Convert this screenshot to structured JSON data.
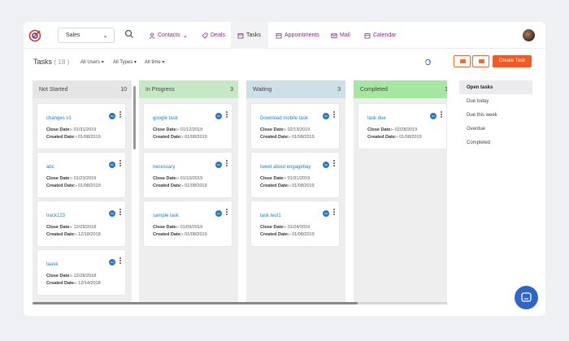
{
  "nav": {
    "dropdown": "Sales",
    "items": [
      {
        "label": "Contacts",
        "icon": "contacts-icon"
      },
      {
        "label": "Deals",
        "icon": "deals-icon"
      },
      {
        "label": "Tasks",
        "icon": "tasks-icon",
        "active": true
      },
      {
        "label": "Appointments",
        "icon": "calendar-icon"
      },
      {
        "label": "Mail",
        "icon": "mail-icon"
      },
      {
        "label": "Calendar",
        "icon": "calendar-icon"
      }
    ]
  },
  "header": {
    "title": "Tasks",
    "count": "( 18 )",
    "filters": [
      "All Users",
      "All Types",
      "All time"
    ],
    "create_label": "Create Task"
  },
  "columns": [
    {
      "name": "Not Started",
      "count": "10",
      "color": "#e5e5e5",
      "cards": [
        {
          "name": "changes v1",
          "close": "01/31/2019",
          "created": "01/08/2019"
        },
        {
          "name": "abc",
          "close": "01/23/2019",
          "created": "01/08/2019"
        },
        {
          "name": "track123",
          "close": "12/29/2018",
          "created": "12/18/2018"
        },
        {
          "name": "taask",
          "close": "12/28/2018",
          "created": "12/14/2018"
        }
      ]
    },
    {
      "name": "In Progress",
      "count": "3",
      "color": "#c7e8c4",
      "cards": [
        {
          "name": "google task",
          "close": "01/12/2019",
          "created": "01/08/2019"
        },
        {
          "name": "necessary",
          "close": "01/10/2019",
          "created": "01/08/2019"
        },
        {
          "name": "sample task",
          "close": "01/09/2019",
          "created": "01/08/2019"
        }
      ]
    },
    {
      "name": "Waiting",
      "count": "3",
      "color": "#cde0e8",
      "cards": [
        {
          "name": "Download mobile task",
          "close": "02/13/2019",
          "created": "01/08/2019"
        },
        {
          "name": "tweet about engagebay",
          "close": "01/31/2019",
          "created": "01/08/2019"
        },
        {
          "name": "task test1",
          "close": "01/24/2019",
          "created": "01/08/2019"
        }
      ]
    },
    {
      "name": "Completed",
      "count": "1",
      "color": "#a6e8a2",
      "cards": [
        {
          "name": "task due",
          "close": "02/28/2019",
          "created": "01/08/2019"
        }
      ]
    }
  ],
  "card_labels": {
    "close": "Close Date:-",
    "created": "Created Date:-",
    "badge": "SA"
  },
  "right_panel": [
    "Open tasks",
    "Due today",
    "Due this week",
    "Overdue",
    "Completed"
  ]
}
